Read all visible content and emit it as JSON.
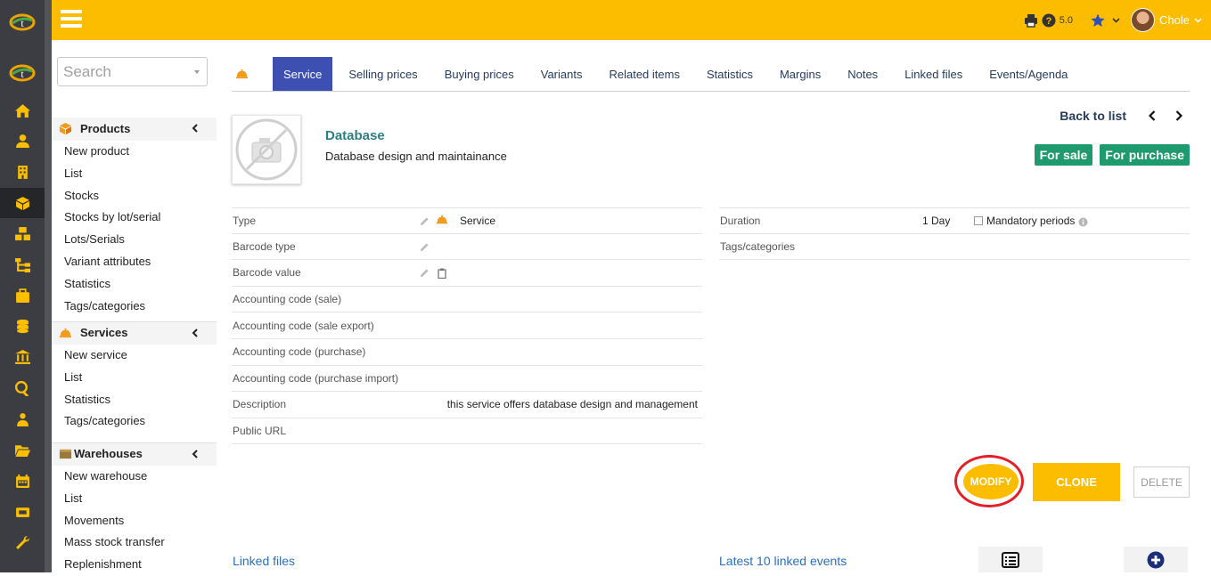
{
  "topbar": {
    "version": "5.0",
    "user_name": "Chole"
  },
  "rail": {
    "items": [
      "home-icon",
      "user-icon",
      "building-icon",
      "cube-icon",
      "cubes-icon",
      "sitemap-icon",
      "briefcase-icon",
      "coins-icon",
      "bank-icon",
      "search-dollar-icon",
      "users-icon",
      "folder-open-icon",
      "calendar-icon",
      "ticket-icon",
      "wrench-icon"
    ],
    "active_index": 3
  },
  "search": {
    "placeholder": "Search"
  },
  "menu": {
    "products": {
      "title": "Products",
      "items": [
        "New product",
        "List",
        "Stocks",
        "Stocks by lot/serial",
        "Lots/Serials",
        "Variant attributes",
        "Statistics",
        "Tags/categories"
      ]
    },
    "services": {
      "title": "Services",
      "items": [
        "New service",
        "List",
        "Statistics",
        "Tags/categories"
      ]
    },
    "warehouses": {
      "title": "Warehouses",
      "items": [
        "New warehouse",
        "List",
        "Movements",
        "Mass stock transfer",
        "Replenishment"
      ]
    }
  },
  "tabs": [
    {
      "label": "Service",
      "active": true
    },
    {
      "label": "Selling prices",
      "active": false
    },
    {
      "label": "Buying prices",
      "active": false
    },
    {
      "label": "Variants",
      "active": false
    },
    {
      "label": "Related items",
      "active": false
    },
    {
      "label": "Statistics",
      "active": false
    },
    {
      "label": "Margins",
      "active": false
    },
    {
      "label": "Notes",
      "active": false
    },
    {
      "label": "Linked files",
      "active": false
    },
    {
      "label": "Events/Agenda",
      "active": false
    }
  ],
  "record": {
    "ref": "Database",
    "label": "Database design and maintainance",
    "back_to_list": "Back to list",
    "badges": [
      "For sale",
      "For purchase"
    ]
  },
  "fields_left": [
    {
      "label": "Type",
      "value": "Service"
    },
    {
      "label": "Barcode type",
      "value": ""
    },
    {
      "label": "Barcode value",
      "value": ""
    },
    {
      "label": "Accounting code (sale)",
      "value": ""
    },
    {
      "label": "Accounting code (sale export)",
      "value": ""
    },
    {
      "label": "Accounting code (purchase)",
      "value": ""
    },
    {
      "label": "Accounting code (purchase import)",
      "value": ""
    },
    {
      "label": "Description",
      "value": "this service offers database design and management"
    },
    {
      "label": "Public URL",
      "value": ""
    }
  ],
  "fields_right": [
    {
      "label": "Duration",
      "value": "1 Day",
      "extra": "Mandatory periods"
    },
    {
      "label": "Tags/categories",
      "value": ""
    }
  ],
  "actions": {
    "modify": "MODIFY",
    "clone": "CLONE",
    "delete": "DELETE"
  },
  "sections": {
    "linked_files": "Linked files",
    "latest_events": "Latest 10 linked events"
  },
  "colors": {
    "topbar": "#fcbd00",
    "rail": "#3b3d42",
    "active_tab": "#3d4fb0",
    "badge": "#1f9a6f",
    "title": "#2d7f82",
    "highlight_ring": "#e41f26"
  }
}
